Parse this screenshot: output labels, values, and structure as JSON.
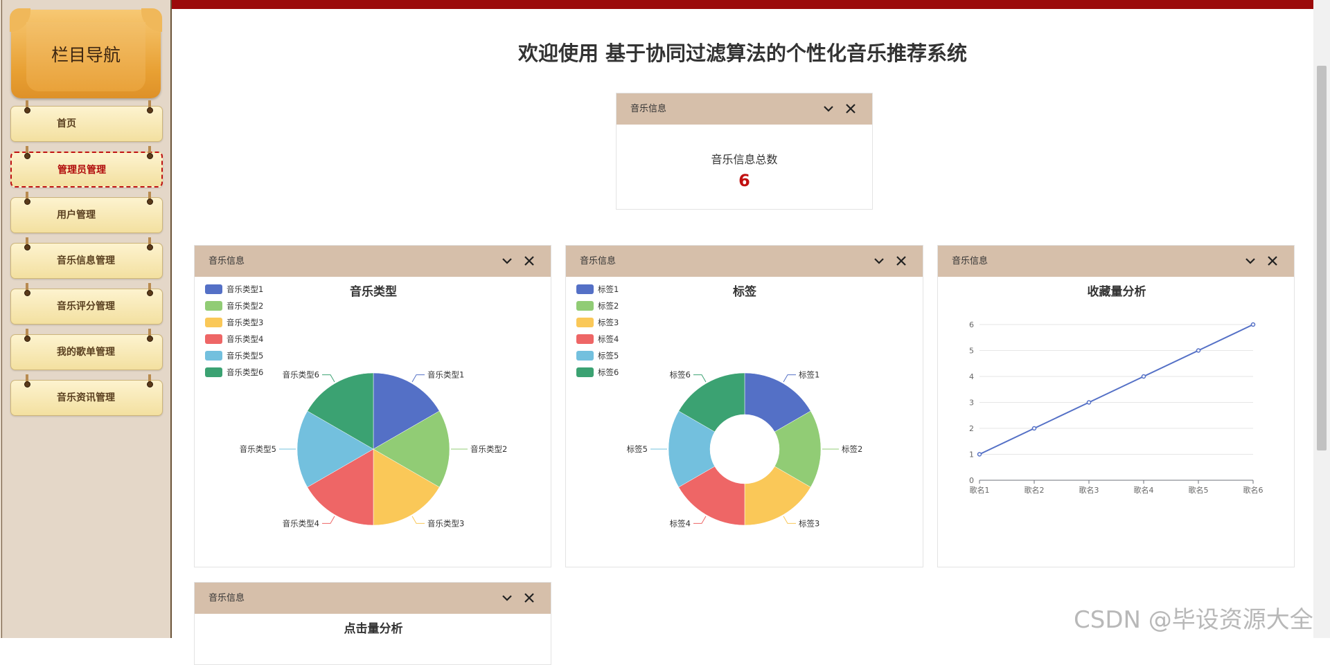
{
  "sidebar": {
    "title": "栏目导航",
    "items": [
      {
        "label": "首页",
        "active": false
      },
      {
        "label": "管理员管理",
        "active": true
      },
      {
        "label": "用户管理",
        "active": false
      },
      {
        "label": "音乐信息管理",
        "active": false
      },
      {
        "label": "音乐评分管理",
        "active": false
      },
      {
        "label": "我的歌单管理",
        "active": false
      },
      {
        "label": "音乐资讯管理",
        "active": false
      }
    ]
  },
  "main": {
    "title": "欢迎使用 基于协同过滤算法的个性化音乐推荐系统",
    "stat_panel": {
      "header": "音乐信息",
      "label": "音乐信息总数",
      "value": "6"
    },
    "panels": [
      {
        "header": "音乐信息"
      },
      {
        "header": "音乐信息"
      },
      {
        "header": "音乐信息"
      },
      {
        "header": "音乐信息"
      }
    ]
  },
  "watermark": "CSDN @毕设资源大全",
  "colors": {
    "topbar": "#9b0a0a",
    "panel_header": "#d6bfaa",
    "stat_value": "#c11010",
    "palette": [
      "#5470c6",
      "#91cc75",
      "#fac858",
      "#ee6666",
      "#73c0de",
      "#3ba272"
    ]
  },
  "chart_data": [
    {
      "type": "pie",
      "title": "音乐类型",
      "categories": [
        "音乐类型1",
        "音乐类型2",
        "音乐类型3",
        "音乐类型4",
        "音乐类型5",
        "音乐类型6"
      ],
      "values": [
        1,
        1,
        1,
        1,
        1,
        1
      ],
      "legend": "top-left"
    },
    {
      "type": "pie",
      "title": "标签",
      "donut": true,
      "categories": [
        "标签1",
        "标签2",
        "标签3",
        "标签4",
        "标签5",
        "标签6"
      ],
      "values": [
        1,
        1,
        1,
        1,
        1,
        1
      ],
      "legend": "top-left"
    },
    {
      "type": "line",
      "title": "收藏量分析",
      "categories": [
        "歌名1",
        "歌名2",
        "歌名3",
        "歌名4",
        "歌名5",
        "歌名6"
      ],
      "values": [
        1,
        2,
        3,
        4,
        5,
        6
      ],
      "ylim": [
        0,
        6
      ],
      "yticks": [
        "0",
        "1",
        "2",
        "3",
        "4",
        "5",
        "6"
      ],
      "grid": true
    },
    {
      "type": "line",
      "title": "点击量分析"
    }
  ]
}
